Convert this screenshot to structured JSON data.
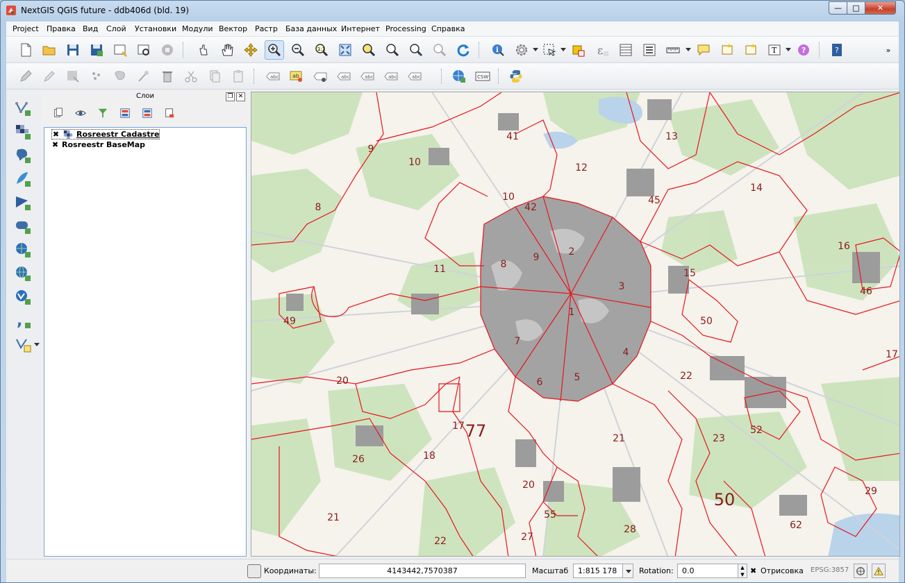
{
  "window": {
    "title": "NextGIS QGIS future - ddb406d (bld. 19)"
  },
  "menubar": {
    "items": [
      "Project",
      "Правка",
      "Вид",
      "Слой",
      "Установки",
      "Модули",
      "Вектор",
      "Растр",
      "База данных",
      "Интернет",
      "Processing",
      "Справка"
    ]
  },
  "layers_panel": {
    "title": "Слои",
    "layers": [
      {
        "name": "Rosreestr Cadastre",
        "checked": true,
        "selected": true
      },
      {
        "name": "Rosreestr BaseMap",
        "checked": true,
        "selected": false
      }
    ]
  },
  "toolbar2": {
    "label_abc": "abc",
    "label_ab": "ab",
    "csw": "CSW"
  },
  "map": {
    "region_labels": [
      "9",
      "10",
      "41",
      "13",
      "12",
      "10",
      "42",
      "45",
      "14",
      "8",
      "2",
      "9",
      "16",
      "11",
      "8",
      "3",
      "15",
      "46",
      "1",
      "50",
      "49",
      "7",
      "4",
      "17",
      "20",
      "6",
      "5",
      "22",
      "17",
      "77",
      "21",
      "23",
      "52",
      "26",
      "18",
      "20",
      "50",
      "29",
      "21",
      "55",
      "62",
      "27",
      "28",
      "22"
    ]
  },
  "statusbar": {
    "coords_label": "Координаты:",
    "coords_value": "4143442,7570387",
    "scale_label": "Масштаб",
    "scale_value": "1:815 178",
    "rotation_label": "Rotation:",
    "rotation_value": "0.0",
    "render_label": "Отрисовка",
    "render_checked": true,
    "epsg": "EPSG:3857"
  },
  "colors": {
    "boundary": "#e8141c",
    "label": "#8b1a1a",
    "urban": "#9a9a9a",
    "forest": "#c8e0b8"
  }
}
